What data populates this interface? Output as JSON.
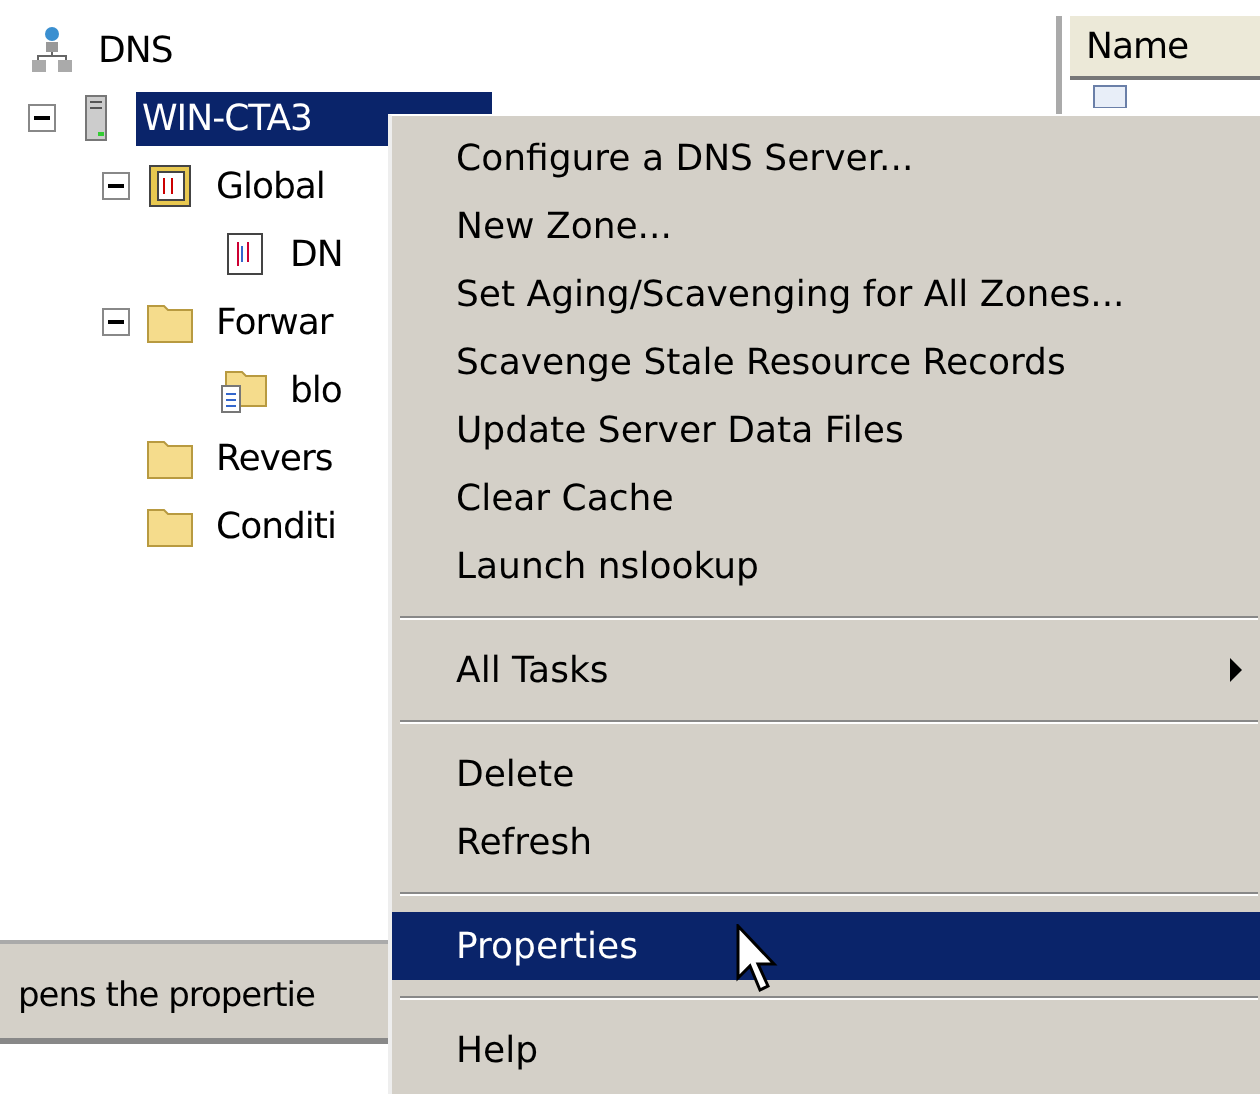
{
  "tree": [
    {
      "label": "DNS",
      "kind": "root",
      "selected": false,
      "children": [
        {
          "label": "WIN-CTA3",
          "kind": "server",
          "selected": true,
          "expanded": true,
          "children": [
            {
              "label": "Global",
              "kind": "logs",
              "selected": false,
              "expanded": true,
              "children": [
                {
                  "label": "DN",
                  "kind": "log",
                  "selected": false
                }
              ]
            },
            {
              "label": "Forwar",
              "kind": "folder",
              "selected": false,
              "expanded": true,
              "children": [
                {
                  "label": "blo",
                  "kind": "zone",
                  "selected": false
                }
              ]
            },
            {
              "label": "Revers",
              "kind": "folder",
              "selected": false
            },
            {
              "label": "Conditi",
              "kind": "folder",
              "selected": false
            }
          ]
        }
      ]
    }
  ],
  "list": {
    "columns": [
      "Name"
    ]
  },
  "status_bar": "pens the propertie",
  "context_menu": [
    {
      "kind": "item",
      "label": "Configure a DNS Server...",
      "selected": false
    },
    {
      "kind": "item",
      "label": "New Zone...",
      "selected": false
    },
    {
      "kind": "item",
      "label": "Set Aging/Scavenging for All Zones...",
      "selected": false
    },
    {
      "kind": "item",
      "label": "Scavenge Stale Resource Records",
      "selected": false
    },
    {
      "kind": "item",
      "label": "Update Server Data Files",
      "selected": false
    },
    {
      "kind": "item",
      "label": "Clear Cache",
      "selected": false
    },
    {
      "kind": "item",
      "label": "Launch nslookup",
      "selected": false
    },
    {
      "kind": "separator"
    },
    {
      "kind": "submenu",
      "label": "All Tasks",
      "selected": false
    },
    {
      "kind": "separator"
    },
    {
      "kind": "item",
      "label": "Delete",
      "selected": false
    },
    {
      "kind": "item",
      "label": "Refresh",
      "selected": false
    },
    {
      "kind": "separator"
    },
    {
      "kind": "item",
      "label": "Properties",
      "selected": true
    },
    {
      "kind": "separator"
    },
    {
      "kind": "item",
      "label": "Help",
      "selected": false
    }
  ]
}
